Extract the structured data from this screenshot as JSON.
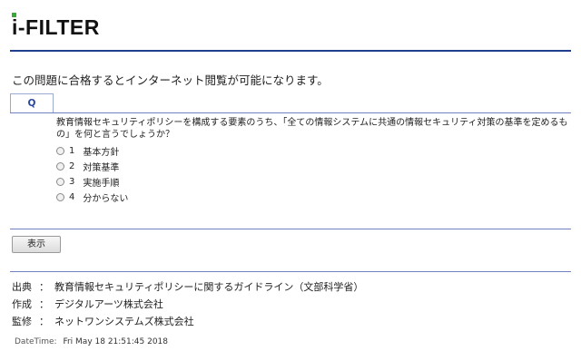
{
  "header": {
    "logo_text": "i-FILTER",
    "rule_color": "#1f3f8c",
    "dot_color": "#3aa935"
  },
  "intro": {
    "text": "この問題に合格するとインターネット閲覧が可能になります。"
  },
  "quiz": {
    "tab_label": "Q",
    "question": "教育情報セキュリティポリシーを構成する要素のうち、「全ての情報システムに共通の情報セキュリティ対策の基準を定めるもの」を何と言うでしょうか？",
    "options": [
      {
        "number": "1",
        "label": "基本方針"
      },
      {
        "number": "2",
        "label": "対策基準"
      },
      {
        "number": "3",
        "label": "実施手順"
      },
      {
        "number": "4",
        "label": "分からない"
      }
    ],
    "submit_label": "表示"
  },
  "footer": {
    "rows": [
      {
        "label": "出典",
        "separator": "：",
        "value": "教育情報セキュリティポリシーに関するガイドライン（文部科学省）"
      },
      {
        "label": "作成",
        "separator": "：",
        "value": "デジタルアーツ株式会社"
      },
      {
        "label": "監修",
        "separator": "：",
        "value": "ネットワンシステムズ株式会社"
      }
    ],
    "datetime_label": "DateTime:",
    "datetime_value": "Fri May 18 21:51:45 2018"
  }
}
